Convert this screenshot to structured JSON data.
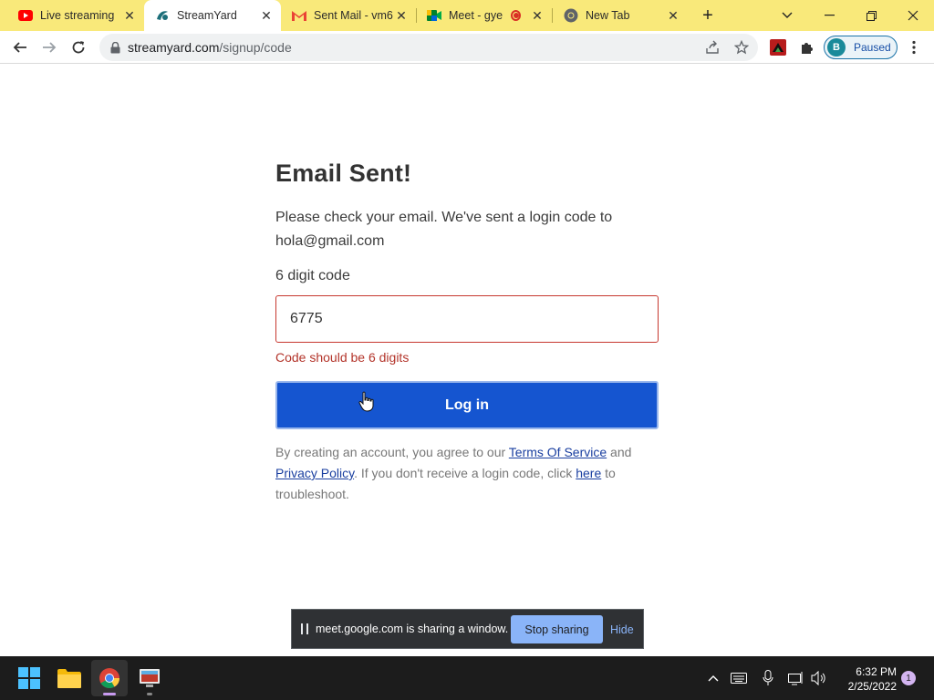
{
  "browser": {
    "tabs": [
      {
        "title": "Live streaming",
        "icon": "youtube-icon",
        "active": false
      },
      {
        "title": "StreamYard",
        "icon": "streamyard-icon",
        "active": true
      },
      {
        "title": "Sent Mail - vm6",
        "icon": "gmail-icon",
        "active": false
      },
      {
        "title": "Meet - gye",
        "icon": "google-meet-icon",
        "active": false,
        "recording": true
      },
      {
        "title": "New Tab",
        "icon": "chrome-icon",
        "active": false
      }
    ],
    "new_tab_label": "+",
    "url_host": "streamyard.com",
    "url_path": "/signup/code",
    "profile_initial": "B",
    "profile_status": "Paused"
  },
  "page": {
    "title": "Email Sent!",
    "description": "Please check your email. We've sent a login code to hola@gmail.com",
    "code_label": "6 digit code",
    "code_value": "6775",
    "error": "Code should be 6 digits",
    "login_label": "Log in",
    "legal": {
      "prefix": "By creating an account, you agree to our ",
      "terms": "Terms Of Service",
      "and": " and ",
      "privacy": "Privacy Policy",
      "middle": ". If you don't receive a login code, click ",
      "here": "here",
      "suffix": " to troubleshoot."
    }
  },
  "sharing_bar": {
    "message": "meet.google.com is sharing a window.",
    "stop_label": "Stop sharing",
    "hide_label": "Hide"
  },
  "taskbar": {
    "time": "6:32 PM",
    "date": "2/25/2022",
    "notification_count": "1"
  },
  "colors": {
    "tab_strip": "#f9e97a",
    "primary_button": "#1555d0",
    "error": "#c7372f",
    "share_button": "#8ab4f8"
  }
}
